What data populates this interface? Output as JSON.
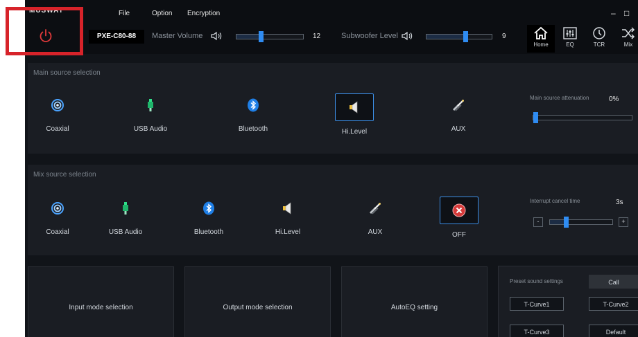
{
  "header": {
    "logo": "MUSWAY",
    "menu": [
      "File",
      "Option",
      "Encryption"
    ],
    "model": "PXE-C80-88",
    "master_volume_label": "Master Volume",
    "master_volume_value": "12",
    "master_volume_level": 0.36,
    "subwoofer_label": "Subwoofer Level",
    "subwoofer_value": "9",
    "subwoofer_level": 0.6,
    "nav": [
      {
        "label": "Home",
        "icon": "home-icon"
      },
      {
        "label": "EQ",
        "icon": "eq-icon"
      },
      {
        "label": "TCR",
        "icon": "clock-icon"
      },
      {
        "label": "Mix",
        "icon": "shuffle-icon"
      }
    ],
    "window_controls": [
      "–",
      "□"
    ]
  },
  "main_source": {
    "title": "Main source selection",
    "items": [
      {
        "label": "Coaxial",
        "icon": "coaxial-icon"
      },
      {
        "label": "USB Audio",
        "icon": "usb-icon"
      },
      {
        "label": "Bluetooth",
        "icon": "bluetooth-icon"
      },
      {
        "label": "Hi.Level",
        "icon": "speaker-icon",
        "selected": true
      },
      {
        "label": "AUX",
        "icon": "aux-cable-icon"
      }
    ],
    "attenuation_label": "Main source attenuation",
    "attenuation_value": "0%",
    "attenuation_level": 0
  },
  "mix_source": {
    "title": "Mix source selection",
    "items": [
      {
        "label": "Coaxial",
        "icon": "coaxial-icon"
      },
      {
        "label": "USB Audio",
        "icon": "usb-icon"
      },
      {
        "label": "Bluetooth",
        "icon": "bluetooth-icon"
      },
      {
        "label": "Hi.Level",
        "icon": "speaker-icon"
      },
      {
        "label": "AUX",
        "icon": "aux-cable-icon"
      },
      {
        "label": "OFF",
        "icon": "off-icon",
        "selected": true
      }
    ],
    "interrupt_label": "Interrupt cancel time",
    "interrupt_value": "3s",
    "interrupt_level": 0.25,
    "minus": "-",
    "plus": "+"
  },
  "cards": [
    "Input mode selection",
    "Output mode selection",
    "AutoEQ setting"
  ],
  "preset": {
    "title": "Preset sound settings",
    "call": "Call",
    "buttons": [
      "T-Curve1",
      "T-Curve2",
      "T-Curve3",
      "Default"
    ]
  },
  "colors": {
    "accent": "#2f8cf2",
    "power": "#e0393a",
    "highlight": "#d7232a"
  }
}
